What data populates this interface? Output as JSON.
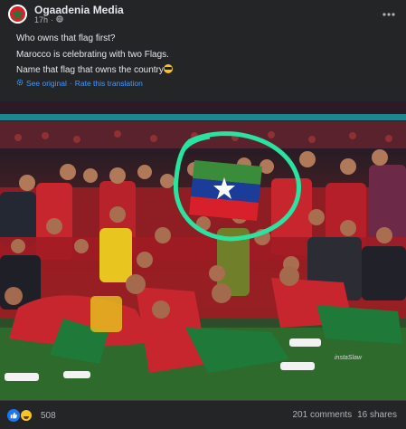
{
  "post": {
    "page_name": "Ogaadenia Media",
    "time": "17h",
    "privacy_icon": "globe-icon",
    "more_icon": "more-horizontal-icon"
  },
  "content": {
    "lines": [
      "Who owns that flag first?",
      "Marocco is celebrating with two Flags.",
      "Name that flag that owns the country"
    ],
    "emoji": "smiling-face-with-sunglasses"
  },
  "translation": {
    "see_original": "See original",
    "separator": "·",
    "rate": "Rate this translation"
  },
  "photo": {
    "watermark": "instaSlaw",
    "highlight_color": "#2be3a0",
    "flag_colors": {
      "top": "#3b8c3a",
      "middle": "#1c3c9a",
      "bottom": "#d8202a",
      "star": "#ffffff"
    }
  },
  "footer": {
    "reaction_count": "508",
    "comments": "201 comments",
    "shares": "16 shares"
  },
  "colors": {
    "background": "#242526",
    "text": "#e4e6eb",
    "secondary": "#b0b3b8",
    "link": "#4599ff",
    "like": "#1877f2"
  }
}
